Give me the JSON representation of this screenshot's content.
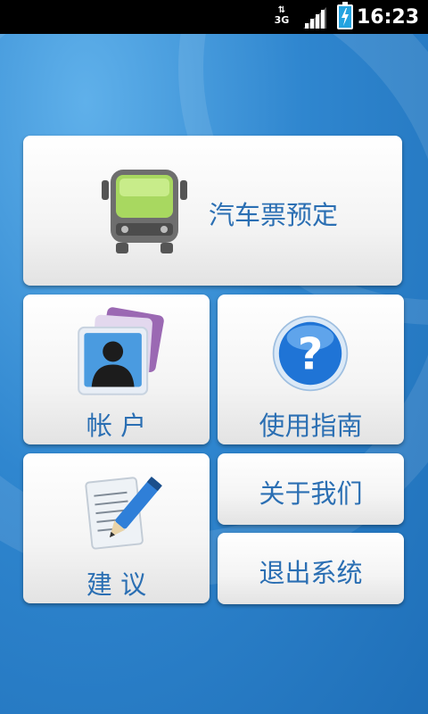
{
  "status_bar": {
    "time": "16:23",
    "network_type": "3G",
    "icons": [
      "data-arrows-icon",
      "signal-icon",
      "battery-charging-icon"
    ]
  },
  "menu": {
    "bus_ticket_label": "汽车票预定",
    "account_label": "帐 户",
    "guide_label": "使用指南",
    "suggestion_label": "建 议",
    "about_label": "关于我们",
    "exit_label": "退出系统"
  },
  "icons": {
    "bus": "bus-icon",
    "account": "contact-card-icon",
    "guide": "question-mark-icon",
    "suggestion": "note-pencil-icon"
  },
  "colors": {
    "label_blue": "#2b6fb3",
    "background_blue": "#2f86cf",
    "bus_window_green": "#a8d860"
  }
}
